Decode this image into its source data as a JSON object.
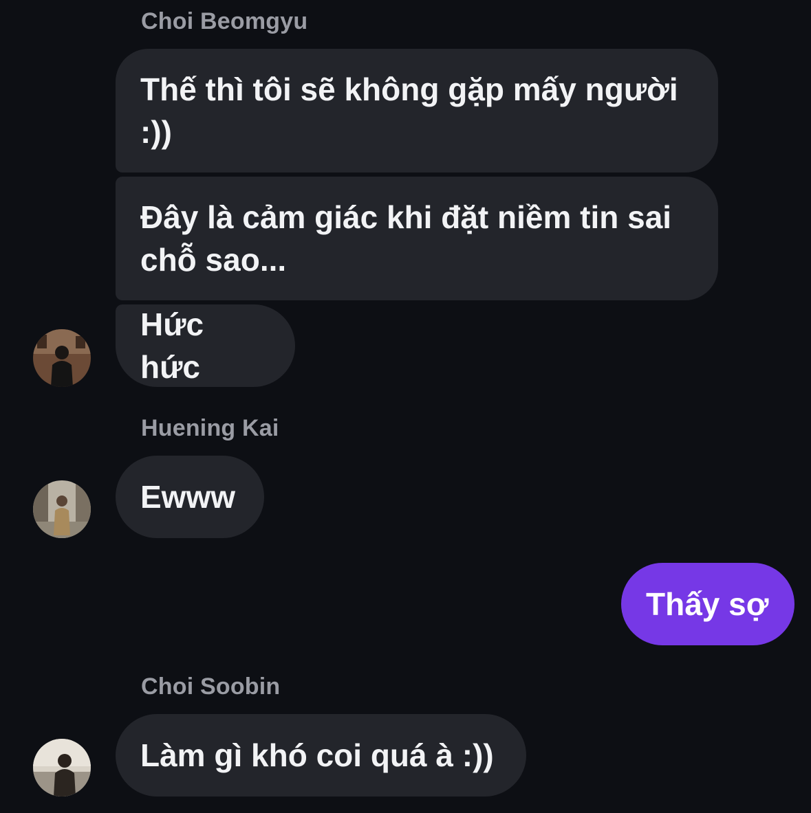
{
  "conversation": {
    "groups": [
      {
        "sender": "Choi Beomgyu",
        "messages": [
          "Thế thì tôi sẽ không gặp mấy người\n:))",
          "Đây là cảm giác khi đặt niềm tin sai\nchỗ sao...",
          "Hức hức"
        ],
        "avatar_icon": "user-photo-icon"
      },
      {
        "sender": "Huening Kai",
        "messages": [
          "Ewww"
        ],
        "avatar_icon": "user-photo-icon"
      },
      {
        "sender": "",
        "outgoing": true,
        "messages": [
          "Thấy sợ"
        ]
      },
      {
        "sender": "Choi Soobin",
        "messages": [
          "Làm gì khó coi quá à :))"
        ],
        "avatar_icon": "user-photo-icon"
      }
    ]
  },
  "colors": {
    "background": "#0d0f14",
    "incoming_bubble": "#23252b",
    "outgoing_bubble": "#7638e6",
    "sender_name": "#9a9ca4",
    "text": "#f2f3f5"
  }
}
